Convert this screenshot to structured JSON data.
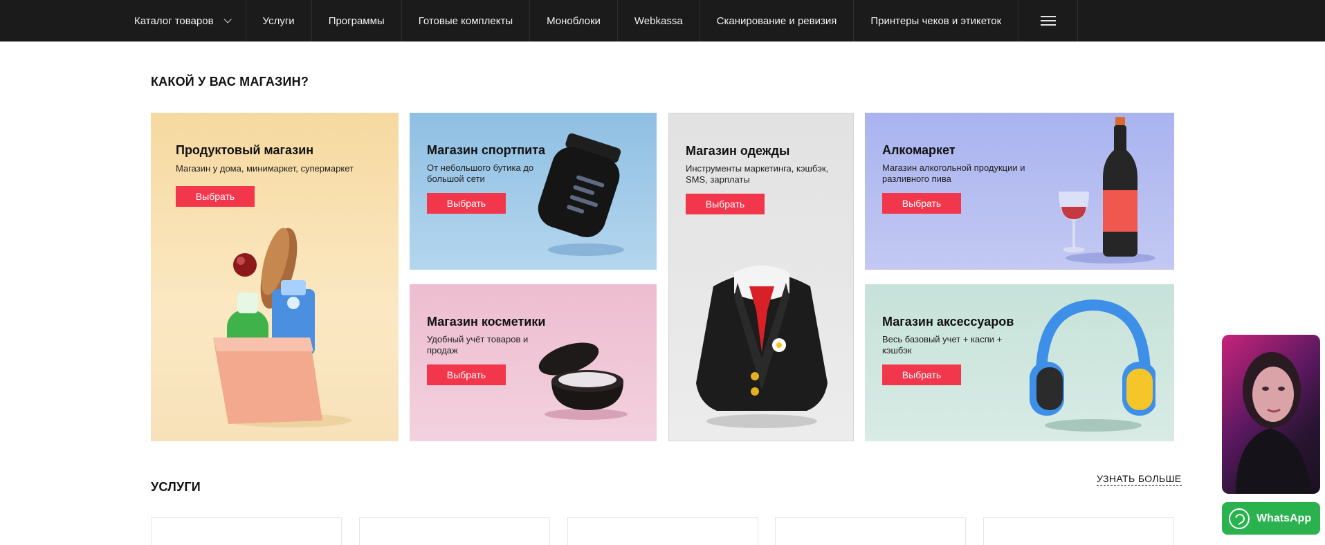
{
  "nav": {
    "items": [
      {
        "label": "Каталог товаров",
        "dropdown": true
      },
      {
        "label": "Услуги"
      },
      {
        "label": "Программы"
      },
      {
        "label": "Готовые комплекты"
      },
      {
        "label": "Моноблоки"
      },
      {
        "label": "Webkassa"
      },
      {
        "label": "Сканирование и ревизия"
      },
      {
        "label": "Принтеры чеков и этикеток"
      }
    ],
    "menu_icon": "hamburger-icon"
  },
  "shop_section": {
    "title": "КАКОЙ У ВАС МАГАЗИН?",
    "button_label": "Выбрать",
    "cards": [
      {
        "title": "Продуктовый магазин",
        "desc": "Магазин у дома, минимаркет, супермаркет",
        "bg": "#f8e2b4",
        "icon": "grocery-bag-icon"
      },
      {
        "title": "Магазин спортпита",
        "desc": "От небольшого бутика до большой сети",
        "bg": "#a2cae8",
        "icon": "protein-jar-icon"
      },
      {
        "title": "Магазин одежды",
        "desc": "Инструменты маркетинга, кэшбэк, SMS, зарплаты",
        "bg": "#e6e6e6",
        "icon": "suit-jacket-icon"
      },
      {
        "title": "Алкомаркет",
        "desc": "Магазин алкогольной продукции и разливного пива",
        "bg": "#b8c0f2",
        "icon": "wine-bottle-icon"
      },
      {
        "title": "Магазин косметики",
        "desc": "Удобный учёт товаров и продаж",
        "bg": "#f0c6d6",
        "icon": "cosmetic-jar-icon"
      },
      {
        "title": "Магазин аксессуаров",
        "desc": "Весь базовый учет + каспи + кэшбэк",
        "bg": "#cfe6df",
        "icon": "headphones-icon"
      }
    ]
  },
  "services_section": {
    "title": "УСЛУГИ",
    "more_label": "УЗНАТЬ БОЛЬШЕ"
  },
  "widgets": {
    "whatsapp_label": "WhatsApp"
  }
}
